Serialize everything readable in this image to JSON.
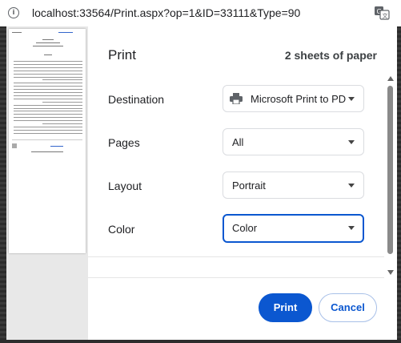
{
  "browser": {
    "url": "localhost:33564/Print.aspx?op=1&ID=33111&Type=90"
  },
  "dialog": {
    "title": "Print",
    "sheets": "2 sheets of paper",
    "rows": [
      {
        "label": "Destination",
        "value": "Microsoft Print to PD",
        "icon": "printer-icon"
      },
      {
        "label": "Pages",
        "value": "All"
      },
      {
        "label": "Layout",
        "value": "Portrait"
      },
      {
        "label": "Color",
        "value": "Color"
      }
    ],
    "print_label": "Print",
    "cancel_label": "Cancel"
  },
  "colors": {
    "accent": "#0b57d0",
    "dialog_bg": "#ffffff",
    "preview_bg": "#e8e8e8"
  }
}
